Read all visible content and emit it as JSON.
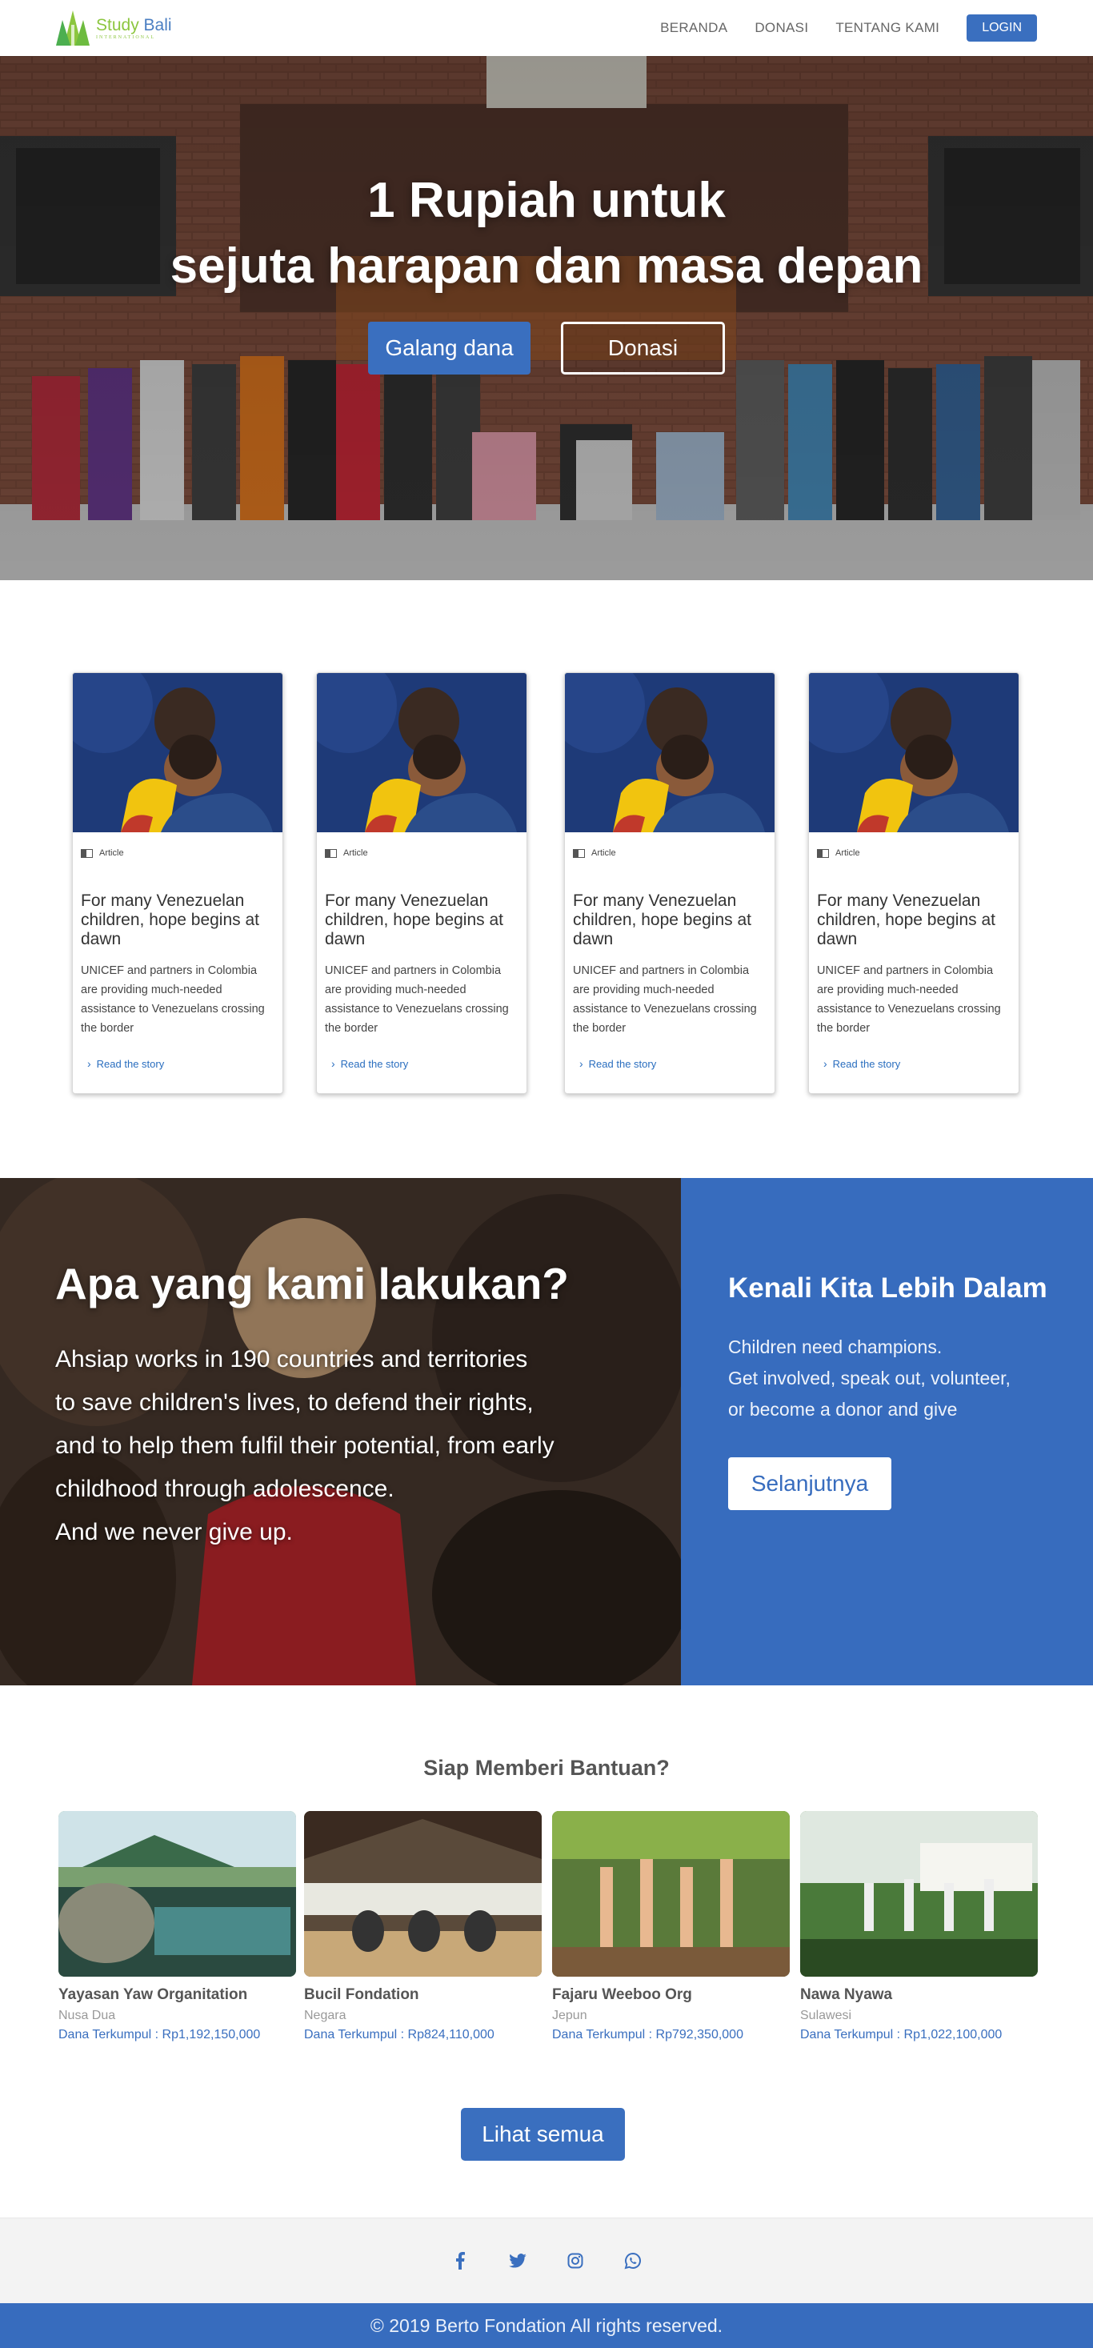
{
  "header": {
    "logo": {
      "part1": "Study",
      "part2": "Bali",
      "subtitle": "INTERNATIONAL"
    },
    "nav": [
      "BERANDA",
      "DONASI",
      "TENTANG KAMI"
    ],
    "login_label": "LOGIN"
  },
  "hero": {
    "title_line1": "1 Rupiah untuk",
    "title_line2": "sejuta harapan dan masa depan",
    "primary_button": "Galang dana",
    "secondary_button": "Donasi"
  },
  "stories": [
    {
      "type": "Article",
      "title": "For many Venezuelan children, hope begins at dawn",
      "description": "UNICEF and partners in Colombia are providing much-needed assistance to Venezuelans crossing the border",
      "link": "Read the story"
    },
    {
      "type": "Article",
      "title": "For many Venezuelan children, hope begins at dawn",
      "description": "UNICEF and partners in Colombia are providing much-needed assistance to Venezuelans crossing the border",
      "link": "Read the story"
    },
    {
      "type": "Article",
      "title": "For many Venezuelan children, hope begins at dawn",
      "description": "UNICEF and partners in Colombia are providing much-needed assistance to Venezuelans crossing the border",
      "link": "Read the story"
    },
    {
      "type": "Article",
      "title": "For many Venezuelan children, hope begins at dawn",
      "description": "UNICEF and partners in Colombia are providing much-needed assistance to Venezuelans crossing the border",
      "link": "Read the story"
    }
  ],
  "what_we_do": {
    "title": "Apa yang kami lakukan?",
    "lines": [
      "Ahsiap works in 190 countries and territories",
      "to save children's lives, to defend their rights,",
      "and to help them fulfil their potential, from early",
      "childhood through adolescence.",
      "And we never give up."
    ],
    "side_title": "Kenali Kita Lebih Dalam",
    "side_lines": [
      "Children need champions.",
      "Get involved, speak out, volunteer,",
      "or become a donor and give"
    ],
    "side_button": "Selanjutnya"
  },
  "ready": {
    "title": "Siap Memberi Bantuan?",
    "orgs": [
      {
        "name": "Yayasan Yaw Organitation",
        "location": "Nusa Dua",
        "fund": "Dana Terkumpul : Rp1,192,150,000"
      },
      {
        "name": "Bucil Fondation",
        "location": "Negara",
        "fund": "Dana Terkumpul : Rp824,110,000"
      },
      {
        "name": "Fajaru Weeboo Org",
        "location": "Jepun",
        "fund": "Dana Terkumpul : Rp792,350,000"
      },
      {
        "name": "Nawa Nyawa",
        "location": "Sulawesi",
        "fund": "Dana Terkumpul : Rp1,022,100,000"
      }
    ],
    "see_all": "Lihat semua"
  },
  "footer": {
    "social_icons": [
      "facebook-icon",
      "twitter-icon",
      "instagram-icon",
      "whatsapp-icon"
    ],
    "copyright": "© 2019 Berto Fondation All rights reserved."
  },
  "colors": {
    "brand_blue": "#3a6fbf",
    "panel_blue": "#376cbe",
    "logo_green": "#8cc63f"
  }
}
